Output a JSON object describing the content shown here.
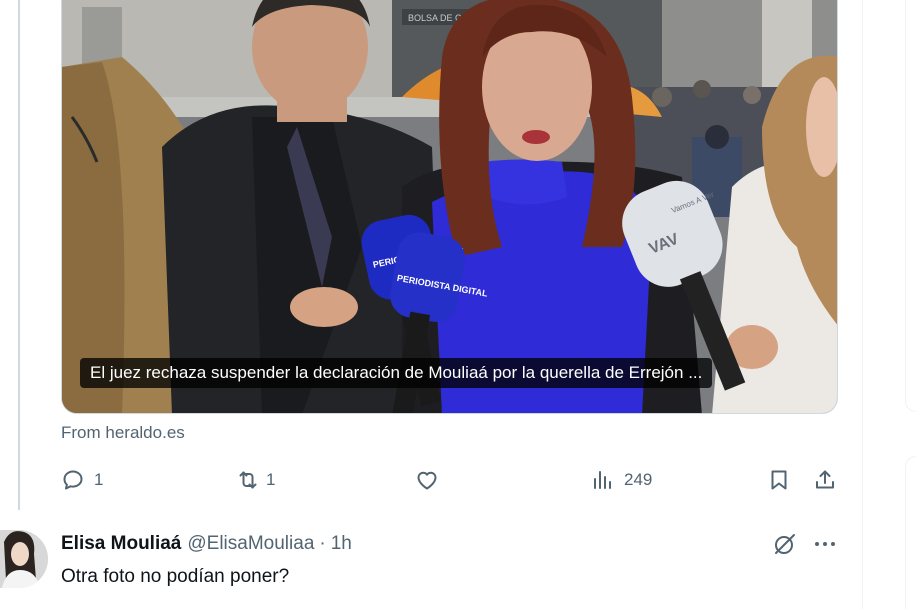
{
  "tweet": {
    "media": {
      "caption": "El juez rechaza suspender la declaración de Mouliaá por la querella de Errejón ...",
      "microphone_labels": [
        "PERIODISTA DIGITAL",
        "PERIODISTA DIGITAL",
        "VAV",
        "Vamos A Ver"
      ],
      "storefront_sign": "BOLSA DE CARRERAS"
    },
    "source": "From heraldo.es",
    "actions": {
      "reply": {
        "icon": "reply-icon",
        "count": "1"
      },
      "retweet": {
        "icon": "retweet-icon",
        "count": "1"
      },
      "like": {
        "icon": "heart-icon",
        "count": ""
      },
      "views": {
        "icon": "views-chart-icon",
        "count": "249"
      },
      "bookmark": {
        "icon": "bookmark-icon"
      },
      "share": {
        "icon": "share-icon"
      }
    }
  },
  "reply": {
    "name": "Elisa Mouliaá",
    "handle": "@ElisaMouliaa",
    "separator": "·",
    "time": "1h",
    "text": "Otra foto no podían poner?",
    "icons": [
      "grok-icon",
      "more-icon"
    ]
  },
  "colors": {
    "secondary_text": "#536471",
    "primary_text": "#0f1419",
    "border": "#cfd9de",
    "sweater_blue": "#2f2bd6",
    "umbrella_orange": "#e08a2e"
  }
}
